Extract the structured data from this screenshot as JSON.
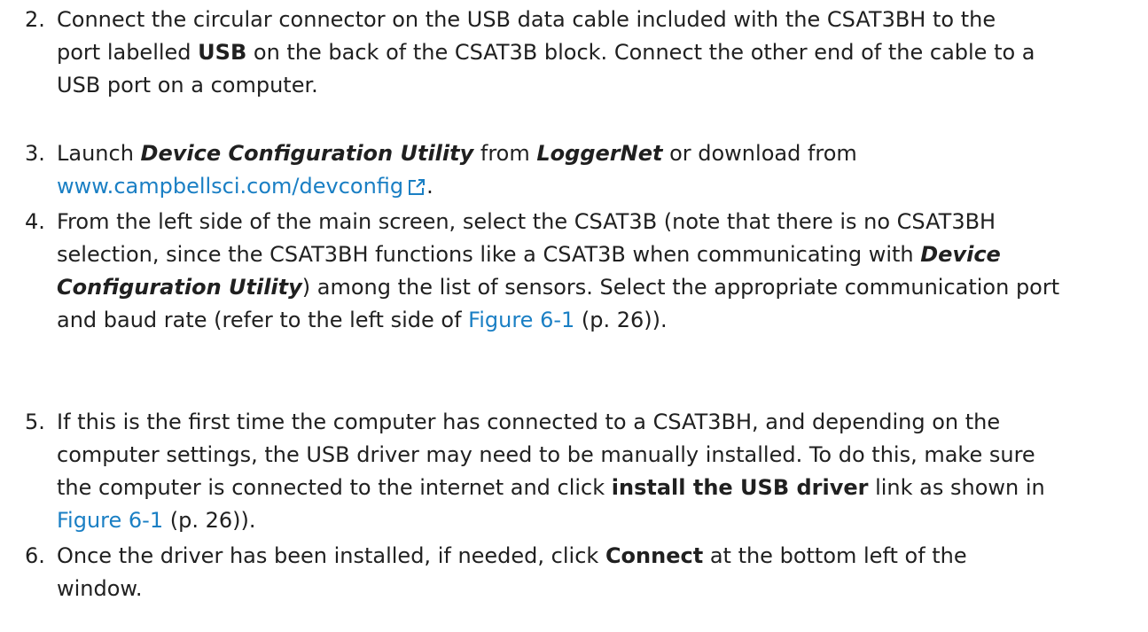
{
  "steps": [
    {
      "number": "2.",
      "lines": [
        [
          {
            "t": "Connect the circular connector on the USB data cable included with the CSAT3BH to the"
          }
        ],
        [
          {
            "t": "port labelled "
          },
          {
            "t": "USB",
            "s": "b"
          },
          {
            "t": " on the back of the CSAT3B block. Connect the other end of the cable to a"
          }
        ],
        [
          {
            "t": "USB port on a computer."
          }
        ]
      ]
    },
    {
      "number": "3.",
      "lines": [
        [
          {
            "t": "Launch "
          },
          {
            "t": "Device Configuration Utility",
            "s": "bi"
          },
          {
            "t": " from "
          },
          {
            "t": "LoggerNet",
            "s": "bi"
          },
          {
            "t": " or download from"
          }
        ],
        [
          {
            "t": "www.campbellsci.com/devconfig",
            "s": "link"
          },
          {
            "t": "",
            "s": "ext",
            "icon": "external-link-icon"
          },
          {
            "t": "."
          }
        ]
      ]
    },
    {
      "number": "4.",
      "lines": [
        [
          {
            "t": "From the left side of the main screen, select the CSAT3B (note that there is no CSAT3BH"
          }
        ],
        [
          {
            "t": "selection, since the CSAT3BH functions like a CSAT3B when communicating with "
          },
          {
            "t": "Device",
            "s": "bi"
          }
        ],
        [
          {
            "t": "Configuration Utility",
            "s": "bi"
          },
          {
            "t": ") among the list of sensors. Select the appropriate communication port"
          }
        ],
        [
          {
            "t": "and baud rate (refer to the left side of "
          },
          {
            "t": "Figure 6-1",
            "s": "link"
          },
          {
            "t": " (p. 26))."
          }
        ]
      ]
    },
    {
      "number": "5.",
      "lines": [
        [
          {
            "t": "If this is the first time the computer has connected to a CSAT3BH, and depending on the"
          }
        ],
        [
          {
            "t": "computer settings, the USB driver may need to be manually installed. To do this, make sure"
          }
        ],
        [
          {
            "t": "the computer is connected to the internet and click "
          },
          {
            "t": "install the USB driver",
            "s": "b"
          },
          {
            "t": " link as shown in"
          }
        ],
        [
          {
            "t": "Figure 6-1",
            "s": "link"
          },
          {
            "t": " (p. 26))."
          }
        ]
      ]
    },
    {
      "number": "6.",
      "lines": [
        [
          {
            "t": "Once the driver has been installed, if needed, click "
          },
          {
            "t": "Connect",
            "s": "b"
          },
          {
            "t": " at the bottom left of the"
          }
        ],
        [
          {
            "t": "window."
          }
        ]
      ]
    }
  ]
}
